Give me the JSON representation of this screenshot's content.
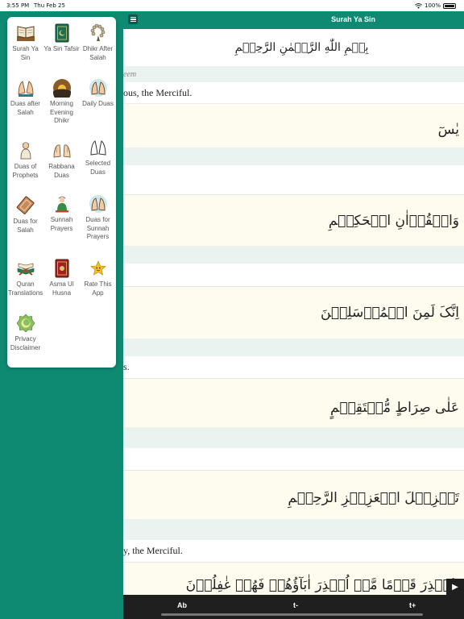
{
  "status_bar": {
    "time": "3:55 PM",
    "date": "Thu Feb 25",
    "battery": "100%"
  },
  "header": {
    "title": "Surah Ya Sin"
  },
  "content": {
    "bismillah": "بِسۡمِ اللّٰهِ الرَّحۡمٰنِ الرَّحِیۡمِ",
    "italic_fragment": "eem",
    "translation_fragment": "ous, the Merciful.",
    "verses": [
      {
        "arabic": "یٰسٓ",
        "translation": ""
      },
      {
        "arabic": "وَالۡقُرۡاٰنِ الۡحَکِیۡمِ",
        "translation": ""
      },
      {
        "arabic": "اِنَّکَ لَمِنَ الۡمُرۡسَلِیۡنَ",
        "translation": "s."
      },
      {
        "arabic": "عَلٰی صِرَاطٍ مُّسۡتَقِیۡمٍ",
        "translation": ""
      },
      {
        "arabic": "تَنۡزِیۡلَ الۡعَزِیۡزِ الرَّحِیۡمِ",
        "translation": "y, the Merciful."
      },
      {
        "arabic": "لِتُنۡذِرَ قَوۡمًا مَّاۤ اُنۡذِرَ اٰبَآؤُهُمۡ فَهُمۡ غٰفِلُوۡنَ",
        "translation": ""
      }
    ]
  },
  "toolbar": {
    "font_button": "Ab",
    "text_smaller": "t-",
    "text_larger": "t+",
    "play": "▶"
  },
  "menu": {
    "items": [
      {
        "label": "Surah Ya Sin",
        "icon": "open-book-icon"
      },
      {
        "label": "Ya Sin Tafsir",
        "icon": "quran-book-icon"
      },
      {
        "label": "Dhikr After Salah",
        "icon": "prayer-beads-icon"
      },
      {
        "label": "Duas after Salah",
        "icon": "praying-hands-icon"
      },
      {
        "label": "Morning Evening Dhikr",
        "icon": "sunrise-icon"
      },
      {
        "label": "Daily Duas",
        "icon": "raised-hands-icon"
      },
      {
        "label": "Duas of Prophets",
        "icon": "prophet-figure-icon"
      },
      {
        "label": "Rabbana Duas",
        "icon": "open-palms-icon"
      },
      {
        "label": "Selected Duas",
        "icon": "hands-outline-icon"
      },
      {
        "label": "Duas for Salah",
        "icon": "prayer-mat-icon"
      },
      {
        "label": "Sunnah Prayers",
        "icon": "praying-boy-icon"
      },
      {
        "label": "Duas for Sunnah Prayers",
        "icon": "hands-in-circle-icon"
      },
      {
        "label": "Quran Translations",
        "icon": "quran-stand-icon"
      },
      {
        "label": "Asma Ul Husna",
        "icon": "red-book-icon"
      },
      {
        "label": "Rate This App",
        "icon": "star-face-icon"
      },
      {
        "label": "Privacy Disclaimer",
        "icon": "badge-icon"
      }
    ]
  },
  "colors": {
    "accent": "#0e8a73",
    "tint_band": "#eaf3ef",
    "cream": "#fdfcef",
    "toolbar": "#1f1f1f"
  }
}
